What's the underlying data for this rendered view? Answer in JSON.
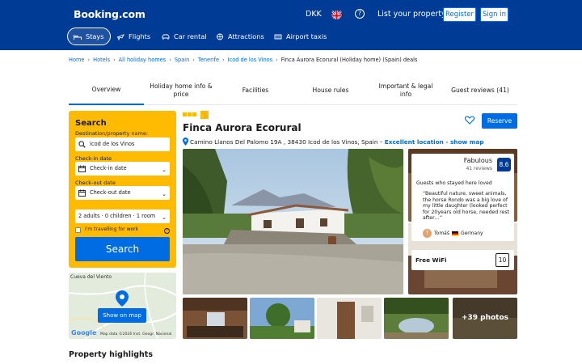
{
  "header": {
    "logo": "Booking.com",
    "currency": "DKK",
    "list_property": "List your property",
    "register": "Register",
    "sign_in": "Sign in",
    "help_glyph": "?",
    "flag_icon": "uk-flag-icon"
  },
  "nav": {
    "stays": "Stays",
    "flights": "Flights",
    "car_rental": "Car rental",
    "attractions": "Attractions",
    "airport_taxis": "Airport taxis"
  },
  "breadcrumb": {
    "home": "Home",
    "hotels": "Hotels",
    "holiday_homes": "All holiday homes",
    "spain": "Spain",
    "tenerife": "Tenerife",
    "icod": "Icod de los Vinos",
    "current": "Finca Aurora Ecorural (Holiday home) (Spain) deals",
    "separator": "›"
  },
  "tabs": {
    "overview": "Overview",
    "info_price": "Holiday home info & price",
    "facilities": "Facilities",
    "house_rules": "House rules",
    "important_legal": "Important & legal info",
    "guest_reviews": "Guest reviews (41)"
  },
  "search": {
    "title": "Search",
    "dest_label": "Destination/property name:",
    "dest_value": "Icod de los Vinos",
    "checkin_label": "Check-in date",
    "checkin_value": "Check-in date",
    "checkout_label": "Check-out date",
    "checkout_value": "Check-out date",
    "guests_value": "2 adults · 0 children · 1 room",
    "work_label": "I'm travelling for work",
    "info_glyph": "?",
    "button": "Search",
    "chevron": "⌄"
  },
  "map": {
    "place_label": "Cueva del Viento",
    "show_on_map": "Show on map",
    "provider": "Google",
    "attribution": "Map data ©2026 Inst. Geogr. Nacional"
  },
  "property": {
    "title": "Finca Aurora Ecorural",
    "address": "Camino Llanos Del Palomo 19A , 38430 Icod de los Vinos, Spain –",
    "location_link": "Excellent location - show map",
    "reserve": "Reserve",
    "stars": 3,
    "thumb_glyph": "👍"
  },
  "review": {
    "rating_text": "Fabulous",
    "count": "41 reviews",
    "score": "8.6",
    "heading": "Guests who stayed here loved",
    "quote": "“Beautiful nature, sweet animals, the horse Rondo was a big love of my little daughter (looked perfect for 20years old horse, needed rest after…”",
    "user_initial": "T",
    "user_name": "Tomáš",
    "user_country": "Germany"
  },
  "wifi": {
    "label": "Free WiFi",
    "score": "10"
  },
  "gallery": {
    "more_photos": "+39 photos"
  },
  "highlights": {
    "title": "Property highlights"
  },
  "colors": {
    "brand_blue": "#003b95",
    "link_blue": "#006ce4",
    "search_yellow": "#febb02"
  }
}
